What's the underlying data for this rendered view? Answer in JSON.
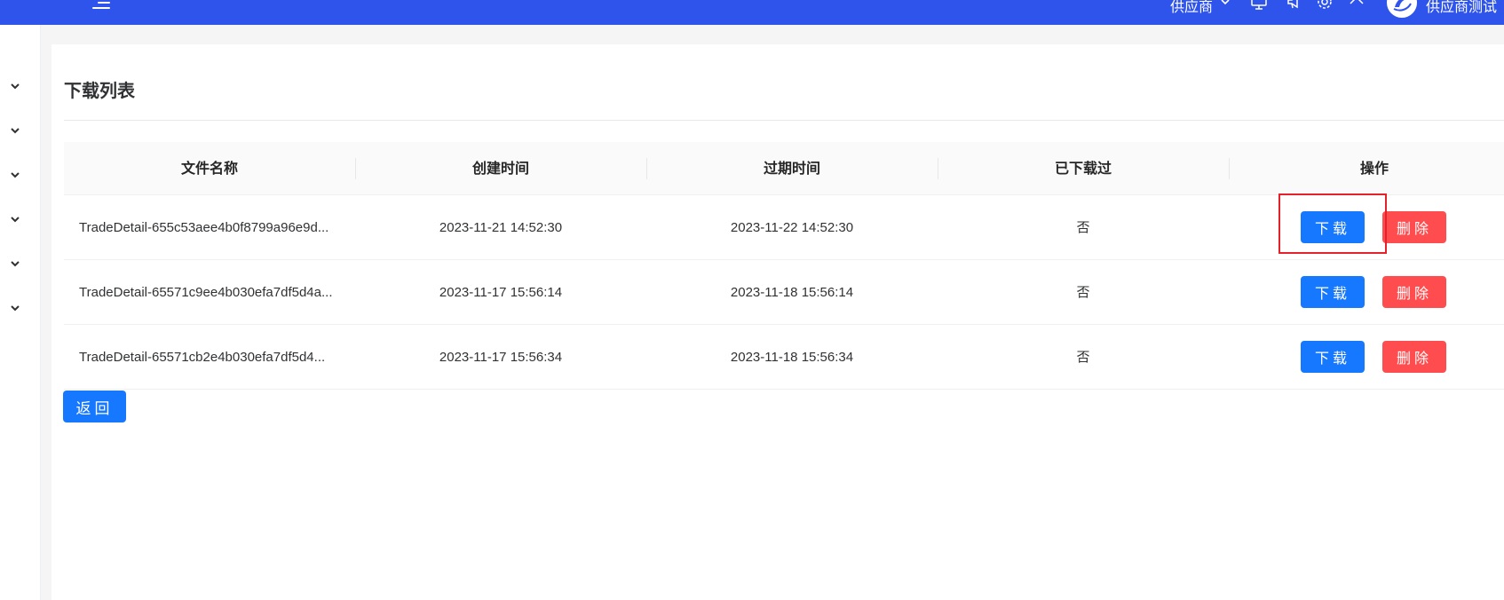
{
  "header": {
    "role_label": "供应商",
    "username": "供应商测试",
    "icons": [
      "menu-icon",
      "chevron-down-icon",
      "monitor-icon",
      "speaker-icon",
      "settings-icon",
      "fullscreen-icon"
    ]
  },
  "sidebar": {
    "items": [
      "chevron-down-icon",
      "chevron-down-icon",
      "chevron-down-icon",
      "chevron-down-icon",
      "chevron-down-icon",
      "chevron-down-icon"
    ]
  },
  "page": {
    "title": "下载列表",
    "back_label": "返回"
  },
  "table": {
    "columns": [
      "文件名称",
      "创建时间",
      "过期时间",
      "已下载过",
      "操作"
    ],
    "rows": [
      {
        "file": "TradeDetail-655c53aee4b0f8799a96e9d...",
        "created": "2023-11-21 14:52:30",
        "expires": "2023-11-22 14:52:30",
        "downloaded": "否",
        "download_label": "下载",
        "delete_label": "删除"
      },
      {
        "file": "TradeDetail-65571c9ee4b030efa7df5d4a...",
        "created": "2023-11-17 15:56:14",
        "expires": "2023-11-18 15:56:14",
        "downloaded": "否",
        "download_label": "下载",
        "delete_label": "删除"
      },
      {
        "file": "TradeDetail-65571cb2e4b030efa7df5d4...",
        "created": "2023-11-17 15:56:34",
        "expires": "2023-11-18 15:56:34",
        "downloaded": "否",
        "download_label": "下载",
        "delete_label": "删除"
      }
    ]
  },
  "colors": {
    "header_bg": "#2f54eb",
    "primary": "#1677ff",
    "danger": "#ff4d4f",
    "highlight": "#e5212a"
  }
}
